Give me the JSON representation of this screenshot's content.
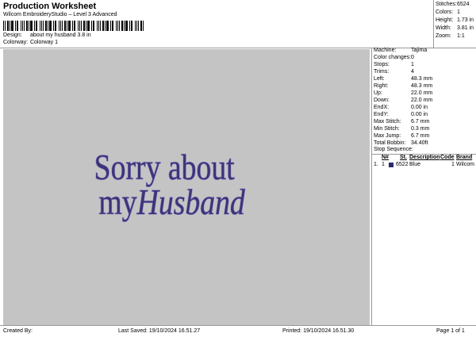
{
  "header": {
    "title": "Production Worksheet",
    "subtitle": "Wilcom EmbroideryStudio – Level 3 Advanced",
    "design_label": "Design:",
    "design_value": "about my husband 3.8 in",
    "colorway_label": "Colorway:",
    "colorway_value": "Colorway 1"
  },
  "stats": [
    {
      "label": "Stitches:",
      "value": "6524"
    },
    {
      "label": "Colors:",
      "value": "1"
    },
    {
      "label": "Height:",
      "value": "1.73 in"
    },
    {
      "label": "Width:",
      "value": "3.81 in"
    },
    {
      "label": "Zoom:",
      "value": "1:1"
    }
  ],
  "design_text": {
    "line1": "Sorry about",
    "line2_plain": "my",
    "line2_italic": "Husband",
    "fill_color": "#3d3478",
    "outline_color": "#8a84c2"
  },
  "machine_info": [
    {
      "label": "Machine:",
      "value": "Tajima"
    },
    {
      "label": "Color changes:",
      "value": "0"
    },
    {
      "label": "Stops:",
      "value": "1"
    },
    {
      "label": "Trims:",
      "value": "4"
    },
    {
      "label": "Left:",
      "value": "48.3 mm"
    },
    {
      "label": "Right:",
      "value": "48.3 mm"
    },
    {
      "label": "Up:",
      "value": "22.0 mm"
    },
    {
      "label": "Down:",
      "value": "22.0 mm"
    },
    {
      "label": "EndX:",
      "value": "0.00 in"
    },
    {
      "label": "EndY:",
      "value": "0.00 in"
    },
    {
      "label": "Max Stitch:",
      "value": "6.7 mm"
    },
    {
      "label": "Min Stitch:",
      "value": "0.3 mm"
    },
    {
      "label": "Max Jump:",
      "value": "6.7 mm"
    },
    {
      "label": "Total Bobbin:",
      "value": "34.40ft"
    }
  ],
  "stop_sequence": {
    "title": "Stop Sequence:",
    "columns": [
      "N#",
      "St.",
      "Description",
      "Code",
      "Brand"
    ],
    "rows": [
      {
        "index": "1.",
        "n": "1",
        "color": "#2c2a6e",
        "stitches": "6522",
        "description": "Blue",
        "code": "1",
        "brand": "Wilcom"
      }
    ]
  },
  "footer": {
    "created_by": "Created By:",
    "last_saved": "Last Saved: 19/10/2024 16.51.27",
    "printed": "Printed: 19/10/2024 16.51.30",
    "page": "Page 1 of 1"
  }
}
